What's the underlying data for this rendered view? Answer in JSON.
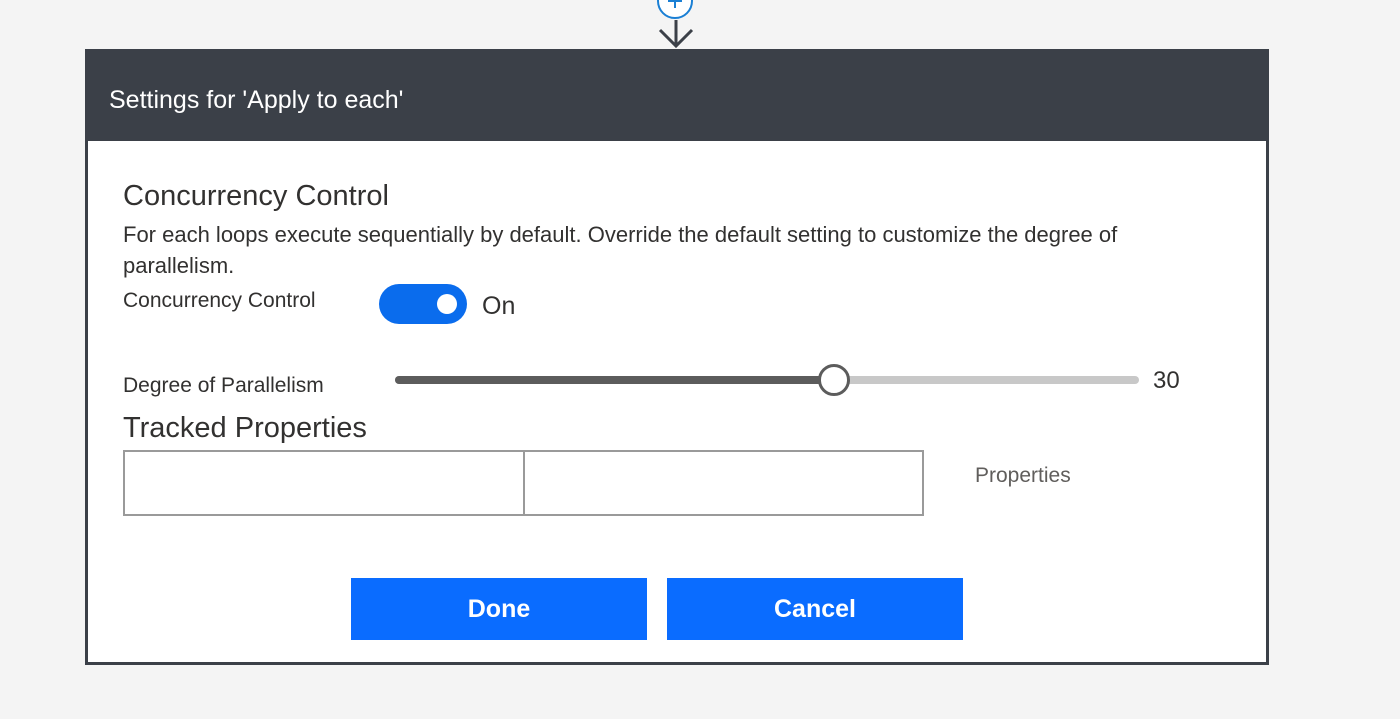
{
  "dialog": {
    "title": "Settings for 'Apply to each'"
  },
  "concurrency": {
    "heading": "Concurrency Control",
    "description": "For each loops execute sequentially by default. Override the default setting to customize the degree of parallelism.",
    "toggle_label": "Concurrency Control",
    "toggle_state": "On",
    "toggle_on": true
  },
  "parallelism": {
    "label": "Degree of Parallelism",
    "value": "30",
    "fraction": 0.59
  },
  "tracked_properties": {
    "heading": "Tracked Properties",
    "key_value": "",
    "value_value": "",
    "hint": "Properties"
  },
  "buttons": {
    "done": "Done",
    "cancel": "Cancel"
  },
  "colors": {
    "header_bg": "#3b4048",
    "accent": "#0a6cff",
    "toggle_on": "#0a6ced",
    "connector": "#1a7fd4"
  },
  "icons": {
    "connector_add": "plus-circle-icon",
    "connector_arrow": "arrow-down-icon"
  }
}
